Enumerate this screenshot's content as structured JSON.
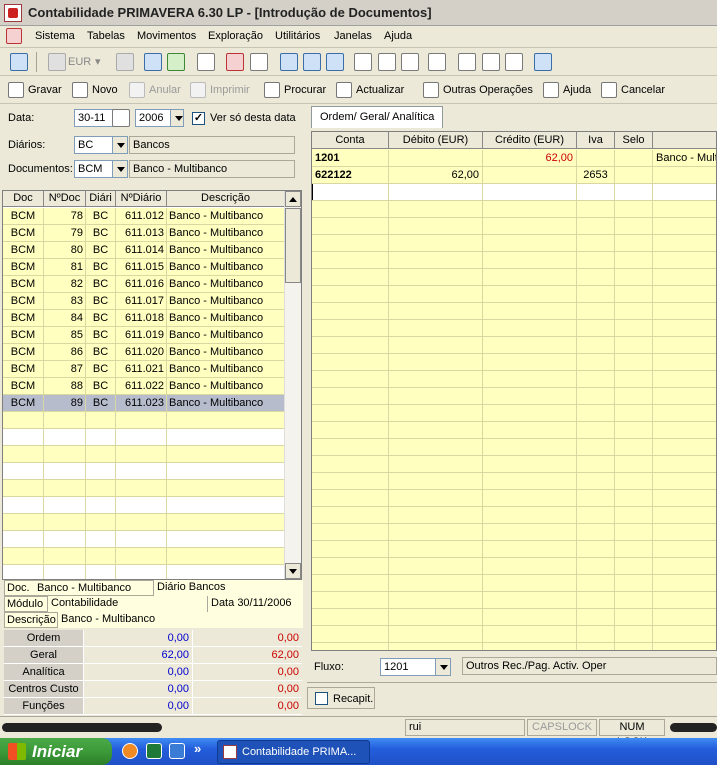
{
  "window": {
    "title": "Contabilidade PRIMAVERA 6.30 LP - [Introdução de Documentos]"
  },
  "menu": [
    "Sistema",
    "Tabelas",
    "Movimentos",
    "Exploração",
    "Utilitários",
    "Janelas",
    "Ajuda"
  ],
  "toolbar1": {
    "currency": "EUR"
  },
  "toolbar2": {
    "gravar": "Gravar",
    "novo": "Novo",
    "anular": "Anular",
    "imprimir": "Imprimir",
    "procurar": "Procurar",
    "actualizar": "Actualizar",
    "outras": "Outras Operações",
    "ajuda": "Ajuda",
    "cancelar": "Cancelar"
  },
  "filters": {
    "data_label": "Data:",
    "data_value": "30-11",
    "year": "2006",
    "ver_so_label": "Ver só desta data",
    "ver_so_checked": "✓",
    "diarios_label": "Diários:",
    "diario_code": "BC",
    "diario_name": "Bancos",
    "documentos_label": "Documentos:",
    "doc_code": "BCM",
    "doc_name": "Banco - Multibanco"
  },
  "doc_grid": {
    "headers": [
      "Doc",
      "NºDoc",
      "Diári",
      "NºDiário",
      "Descrição"
    ],
    "rows": [
      {
        "doc": "BCM",
        "ndoc": "78",
        "diario": "BC",
        "ndiario": "611.012",
        "desc": "Banco - Multibanco"
      },
      {
        "doc": "BCM",
        "ndoc": "79",
        "diario": "BC",
        "ndiario": "611.013",
        "desc": "Banco - Multibanco"
      },
      {
        "doc": "BCM",
        "ndoc": "80",
        "diario": "BC",
        "ndiario": "611.014",
        "desc": "Banco - Multibanco"
      },
      {
        "doc": "BCM",
        "ndoc": "81",
        "diario": "BC",
        "ndiario": "611.015",
        "desc": "Banco - Multibanco"
      },
      {
        "doc": "BCM",
        "ndoc": "82",
        "diario": "BC",
        "ndiario": "611.016",
        "desc": "Banco - Multibanco"
      },
      {
        "doc": "BCM",
        "ndoc": "83",
        "diario": "BC",
        "ndiario": "611.017",
        "desc": "Banco - Multibanco"
      },
      {
        "doc": "BCM",
        "ndoc": "84",
        "diario": "BC",
        "ndiario": "611.018",
        "desc": "Banco - Multibanco"
      },
      {
        "doc": "BCM",
        "ndoc": "85",
        "diario": "BC",
        "ndiario": "611.019",
        "desc": "Banco - Multibanco"
      },
      {
        "doc": "BCM",
        "ndoc": "86",
        "diario": "BC",
        "ndiario": "611.020",
        "desc": "Banco - Multibanco"
      },
      {
        "doc": "BCM",
        "ndoc": "87",
        "diario": "BC",
        "ndiario": "611.021",
        "desc": "Banco - Multibanco"
      },
      {
        "doc": "BCM",
        "ndoc": "88",
        "diario": "BC",
        "ndiario": "611.022",
        "desc": "Banco - Multibanco"
      },
      {
        "doc": "BCM",
        "ndoc": "89",
        "diario": "BC",
        "ndiario": "611.023",
        "desc": "Banco - Multibanco"
      }
    ]
  },
  "doc_info": {
    "doc_label": "Doc.",
    "doc_value": "Banco - Multibanco",
    "diario_label": "Diário",
    "diario_value": "Bancos",
    "modulo_label": "Módulo",
    "modulo_value": "Contabilidade",
    "data_label": "Data",
    "data_value": "30/11/2006",
    "descricao_label": "Descrição",
    "descricao_value": "Banco - Multibanco"
  },
  "totals": [
    {
      "label": "Ordem",
      "v1": "0,00",
      "v2": "0,00"
    },
    {
      "label": "Geral",
      "v1": "62,00",
      "v2": "62,00"
    },
    {
      "label": "Analítica",
      "v1": "0,00",
      "v2": "0,00"
    },
    {
      "label": "Centros Custo",
      "v1": "0,00",
      "v2": "0,00"
    },
    {
      "label": "Funções",
      "v1": "0,00",
      "v2": "0,00"
    }
  ],
  "entry": {
    "tab": "Ordem/ Geral/ Analítica",
    "headers": [
      "Conta",
      "Débito (EUR)",
      "Crédito (EUR)",
      "Iva",
      "Selo",
      ""
    ],
    "rows": [
      {
        "conta": "1201",
        "debito": "",
        "credito": "62,00",
        "iva": "",
        "selo": "",
        "desc": "Banco - Multi"
      },
      {
        "conta": "622122",
        "debito": "62,00",
        "credito": "",
        "iva": "2653",
        "selo": "",
        "desc": ""
      }
    ],
    "fluxo_label": "Fluxo:",
    "fluxo_value": "1201",
    "fluxo_desc": "Outros Rec./Pag. Activ. Oper",
    "recapit_label": "Recapit."
  },
  "status": {
    "user": "rui",
    "caps": "CAPSLOCK",
    "num": "NUM LOCK"
  },
  "taskbar": {
    "start": "Iniciar",
    "window": "Contabilidade PRIMA..."
  }
}
